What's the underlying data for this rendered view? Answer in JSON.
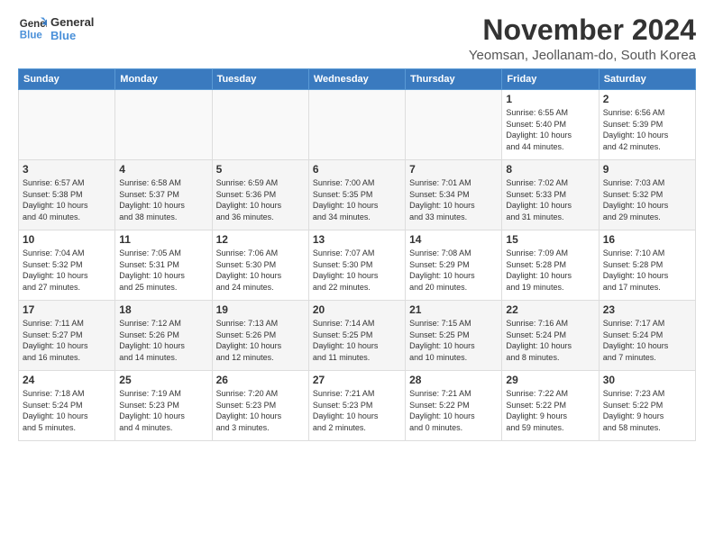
{
  "logo": {
    "line1": "General",
    "line2": "Blue"
  },
  "title": "November 2024",
  "location": "Yeomsan, Jeollanam-do, South Korea",
  "days_of_week": [
    "Sunday",
    "Monday",
    "Tuesday",
    "Wednesday",
    "Thursday",
    "Friday",
    "Saturday"
  ],
  "weeks": [
    [
      {
        "day": "",
        "info": ""
      },
      {
        "day": "",
        "info": ""
      },
      {
        "day": "",
        "info": ""
      },
      {
        "day": "",
        "info": ""
      },
      {
        "day": "",
        "info": ""
      },
      {
        "day": "1",
        "info": "Sunrise: 6:55 AM\nSunset: 5:40 PM\nDaylight: 10 hours\nand 44 minutes."
      },
      {
        "day": "2",
        "info": "Sunrise: 6:56 AM\nSunset: 5:39 PM\nDaylight: 10 hours\nand 42 minutes."
      }
    ],
    [
      {
        "day": "3",
        "info": "Sunrise: 6:57 AM\nSunset: 5:38 PM\nDaylight: 10 hours\nand 40 minutes."
      },
      {
        "day": "4",
        "info": "Sunrise: 6:58 AM\nSunset: 5:37 PM\nDaylight: 10 hours\nand 38 minutes."
      },
      {
        "day": "5",
        "info": "Sunrise: 6:59 AM\nSunset: 5:36 PM\nDaylight: 10 hours\nand 36 minutes."
      },
      {
        "day": "6",
        "info": "Sunrise: 7:00 AM\nSunset: 5:35 PM\nDaylight: 10 hours\nand 34 minutes."
      },
      {
        "day": "7",
        "info": "Sunrise: 7:01 AM\nSunset: 5:34 PM\nDaylight: 10 hours\nand 33 minutes."
      },
      {
        "day": "8",
        "info": "Sunrise: 7:02 AM\nSunset: 5:33 PM\nDaylight: 10 hours\nand 31 minutes."
      },
      {
        "day": "9",
        "info": "Sunrise: 7:03 AM\nSunset: 5:32 PM\nDaylight: 10 hours\nand 29 minutes."
      }
    ],
    [
      {
        "day": "10",
        "info": "Sunrise: 7:04 AM\nSunset: 5:32 PM\nDaylight: 10 hours\nand 27 minutes."
      },
      {
        "day": "11",
        "info": "Sunrise: 7:05 AM\nSunset: 5:31 PM\nDaylight: 10 hours\nand 25 minutes."
      },
      {
        "day": "12",
        "info": "Sunrise: 7:06 AM\nSunset: 5:30 PM\nDaylight: 10 hours\nand 24 minutes."
      },
      {
        "day": "13",
        "info": "Sunrise: 7:07 AM\nSunset: 5:30 PM\nDaylight: 10 hours\nand 22 minutes."
      },
      {
        "day": "14",
        "info": "Sunrise: 7:08 AM\nSunset: 5:29 PM\nDaylight: 10 hours\nand 20 minutes."
      },
      {
        "day": "15",
        "info": "Sunrise: 7:09 AM\nSunset: 5:28 PM\nDaylight: 10 hours\nand 19 minutes."
      },
      {
        "day": "16",
        "info": "Sunrise: 7:10 AM\nSunset: 5:28 PM\nDaylight: 10 hours\nand 17 minutes."
      }
    ],
    [
      {
        "day": "17",
        "info": "Sunrise: 7:11 AM\nSunset: 5:27 PM\nDaylight: 10 hours\nand 16 minutes."
      },
      {
        "day": "18",
        "info": "Sunrise: 7:12 AM\nSunset: 5:26 PM\nDaylight: 10 hours\nand 14 minutes."
      },
      {
        "day": "19",
        "info": "Sunrise: 7:13 AM\nSunset: 5:26 PM\nDaylight: 10 hours\nand 12 minutes."
      },
      {
        "day": "20",
        "info": "Sunrise: 7:14 AM\nSunset: 5:25 PM\nDaylight: 10 hours\nand 11 minutes."
      },
      {
        "day": "21",
        "info": "Sunrise: 7:15 AM\nSunset: 5:25 PM\nDaylight: 10 hours\nand 10 minutes."
      },
      {
        "day": "22",
        "info": "Sunrise: 7:16 AM\nSunset: 5:24 PM\nDaylight: 10 hours\nand 8 minutes."
      },
      {
        "day": "23",
        "info": "Sunrise: 7:17 AM\nSunset: 5:24 PM\nDaylight: 10 hours\nand 7 minutes."
      }
    ],
    [
      {
        "day": "24",
        "info": "Sunrise: 7:18 AM\nSunset: 5:24 PM\nDaylight: 10 hours\nand 5 minutes."
      },
      {
        "day": "25",
        "info": "Sunrise: 7:19 AM\nSunset: 5:23 PM\nDaylight: 10 hours\nand 4 minutes."
      },
      {
        "day": "26",
        "info": "Sunrise: 7:20 AM\nSunset: 5:23 PM\nDaylight: 10 hours\nand 3 minutes."
      },
      {
        "day": "27",
        "info": "Sunrise: 7:21 AM\nSunset: 5:23 PM\nDaylight: 10 hours\nand 2 minutes."
      },
      {
        "day": "28",
        "info": "Sunrise: 7:21 AM\nSunset: 5:22 PM\nDaylight: 10 hours\nand 0 minutes."
      },
      {
        "day": "29",
        "info": "Sunrise: 7:22 AM\nSunset: 5:22 PM\nDaylight: 9 hours\nand 59 minutes."
      },
      {
        "day": "30",
        "info": "Sunrise: 7:23 AM\nSunset: 5:22 PM\nDaylight: 9 hours\nand 58 minutes."
      }
    ]
  ]
}
